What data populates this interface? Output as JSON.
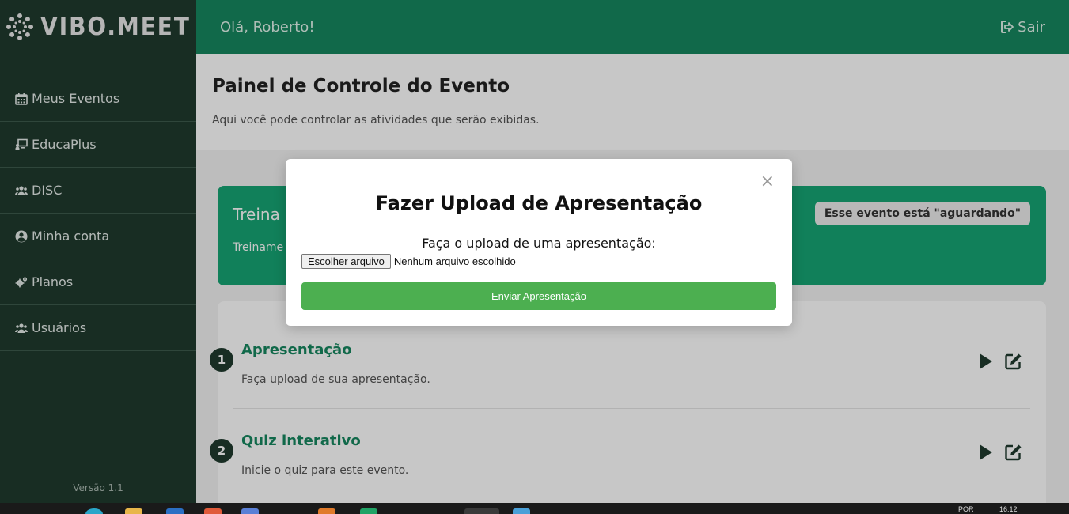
{
  "sidebar": {
    "logo_text": "VIBO.MEET",
    "items": [
      {
        "label": "Meus Eventos",
        "icon": "calendar-icon"
      },
      {
        "label": "EducaPlus",
        "icon": "presentation-icon"
      },
      {
        "label": "DISC",
        "icon": "users-icon"
      },
      {
        "label": "Minha conta",
        "icon": "user-circle-icon"
      },
      {
        "label": "Planos",
        "icon": "gears-icon"
      },
      {
        "label": "Usuários",
        "icon": "users-icon"
      }
    ],
    "version": "Versão 1.1"
  },
  "header": {
    "greeting": "Olá, Roberto!",
    "logout_label": "Sair"
  },
  "page": {
    "title": "Painel de Controle do Evento",
    "subtitle": "Aqui você pode controlar as atividades que serão exibidas."
  },
  "event": {
    "title": "Treina",
    "subtitle": "Treiname",
    "status": "Esse evento está \"aguardando\""
  },
  "steps": [
    {
      "number": "1",
      "title": "Apresentação",
      "description": "Faça upload de sua apresentação."
    },
    {
      "number": "2",
      "title": "Quiz interativo",
      "description": "Inicie o quiz para este evento."
    }
  ],
  "modal": {
    "close": "×",
    "title": "Fazer Upload de Apresentação",
    "label": "Faça o upload de uma apresentação:",
    "file_button": "Escolher arquivo",
    "file_status": "Nenhum arquivo escolhido",
    "submit": "Enviar Apresentação"
  },
  "taskbar": {
    "language": "POR",
    "time": "16:12"
  },
  "colors": {
    "sidebar": "#1f3a2e",
    "header": "#17875f",
    "banner": "#17a574",
    "submit": "#4caf50"
  }
}
